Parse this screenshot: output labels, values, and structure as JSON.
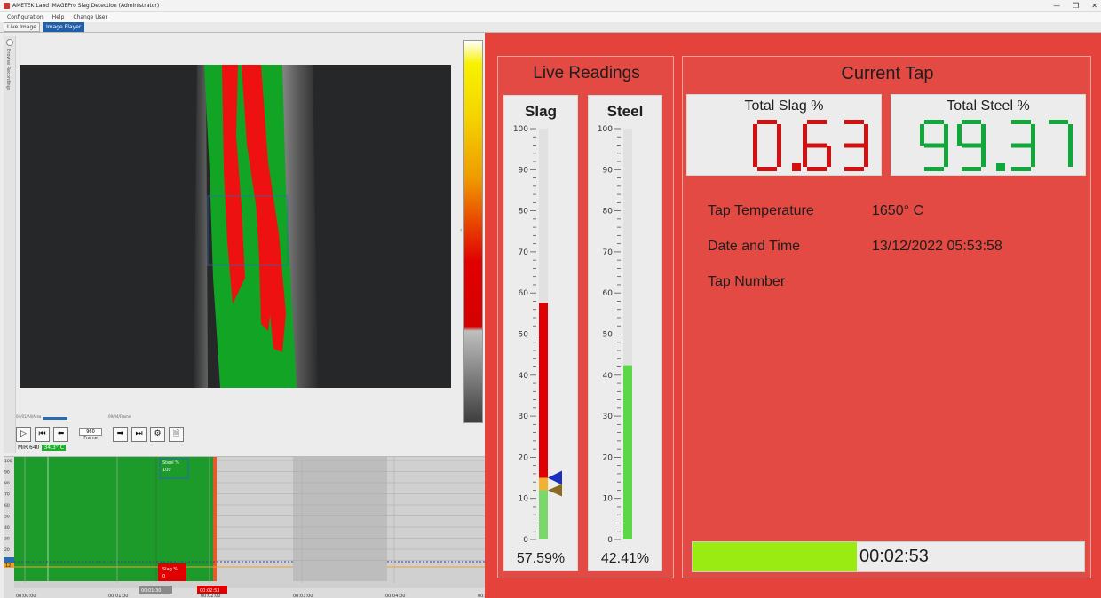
{
  "window": {
    "title": "AMETEK Land IMAGEPro Slag Detection (Administrator)",
    "controls": [
      "—",
      "❐",
      "✕"
    ]
  },
  "menu": [
    "Configuration",
    "Help",
    "Change User"
  ],
  "tabs": [
    {
      "label": "Live Image",
      "active": false
    },
    {
      "label": "Image Player",
      "active": true
    }
  ],
  "side_panel": {
    "label": "Browse Recordings"
  },
  "player": {
    "scrub_left": "04/01/All/Area",
    "scrub_right": "09/04/Frame",
    "frame_value": "960",
    "frame_label": "Frame"
  },
  "camera": {
    "name": "MIR 640",
    "temperature": "34.3° C"
  },
  "trend": {
    "y_ticks": [
      "100",
      "90",
      "80",
      "70",
      "60",
      "50",
      "40",
      "30",
      "20",
      "10"
    ],
    "x_ticks": [
      "00:00:00",
      "00:01:00",
      "00:02:00",
      "00:03:00",
      "00:04:00",
      "00:05:00"
    ],
    "cursor_time": "00:01:30",
    "end_time": "00:02:53",
    "steel_flag": {
      "label": "Steel %",
      "value": "100"
    },
    "slag_flag": {
      "label": "Slag %",
      "value": "0"
    },
    "marker_value": "12"
  },
  "live_readings": {
    "title": "Live Readings",
    "scale_ticks": [
      "100",
      "90",
      "80",
      "70",
      "60",
      "50",
      "40",
      "30",
      "20",
      "10",
      "0"
    ],
    "slag": {
      "title": "Slag",
      "percent_text": "57.59%",
      "level": 57.59,
      "lower_level": 15,
      "green_level": 12,
      "marker_level": 15,
      "color": "#e00000"
    },
    "steel": {
      "title": "Steel",
      "percent_text": "42.41%",
      "level": 42.41,
      "color": "#5dd64a"
    }
  },
  "current_tap": {
    "title": "Current Tap",
    "total_slag": {
      "label": "Total Slag %",
      "value": "0.63",
      "color": "#d40f0f"
    },
    "total_steel": {
      "label": "Total Steel %",
      "value": "99.37",
      "color": "#11a83a"
    },
    "info": [
      {
        "label": "Tap Temperature",
        "value": "1650° C"
      },
      {
        "label": "Date and Time",
        "value": "13/12/2022 05:53:58"
      },
      {
        "label": "Tap Number",
        "value": ""
      }
    ],
    "progress": {
      "fraction": 0.42,
      "time": "00:02:53"
    }
  },
  "colors": {
    "panel_red": "#e34a44",
    "slag_red": "#e00000",
    "steel_green": "#1fae2c",
    "progress_green": "#9aeb12"
  }
}
